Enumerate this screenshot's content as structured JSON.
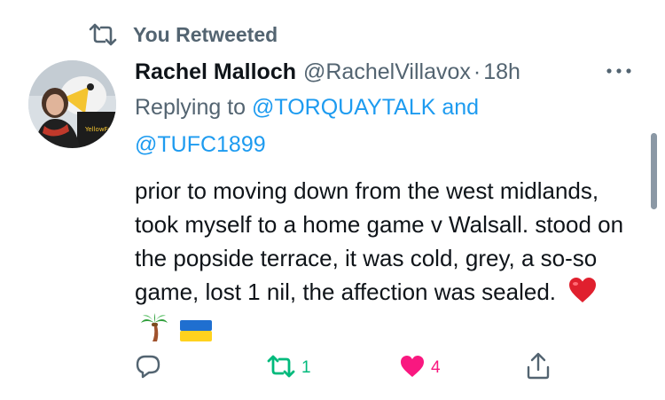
{
  "retweet_header": {
    "text": "You Retweeted",
    "icon": "retweet-icon"
  },
  "author": {
    "display_name": "Rachel Malloch",
    "handle": "@RachelVillavox",
    "separator": "·",
    "time": "18h",
    "avatar_badge_text": "YellowFest"
  },
  "replying": {
    "prefix": "Replying to",
    "mention_1": "@TORQUAYTALK",
    "conjunction": "and",
    "mention_2": "@TUFC1899"
  },
  "tweet": {
    "text": "prior to moving down from the west midlands, took myself to a home game v Walsall. stood on the popside terrace, it was cold, grey, a so-so game, lost 1 nil, the affection was sealed.",
    "emojis": [
      "red-heart-emoji",
      "palm-tree-emoji",
      "ukraine-flag-emoji"
    ]
  },
  "actions": {
    "reply": {
      "icon": "reply-icon",
      "count": ""
    },
    "retweet": {
      "icon": "retweet-icon",
      "count": "1",
      "active": true
    },
    "like": {
      "icon": "heart-icon",
      "count": "4",
      "active": true
    },
    "share": {
      "icon": "share-icon",
      "count": ""
    }
  },
  "colors": {
    "text_primary": "#0f1419",
    "text_secondary": "#536471",
    "link": "#1d9bf0",
    "retweet_green": "#00ba7c",
    "like_pink": "#f91880"
  }
}
